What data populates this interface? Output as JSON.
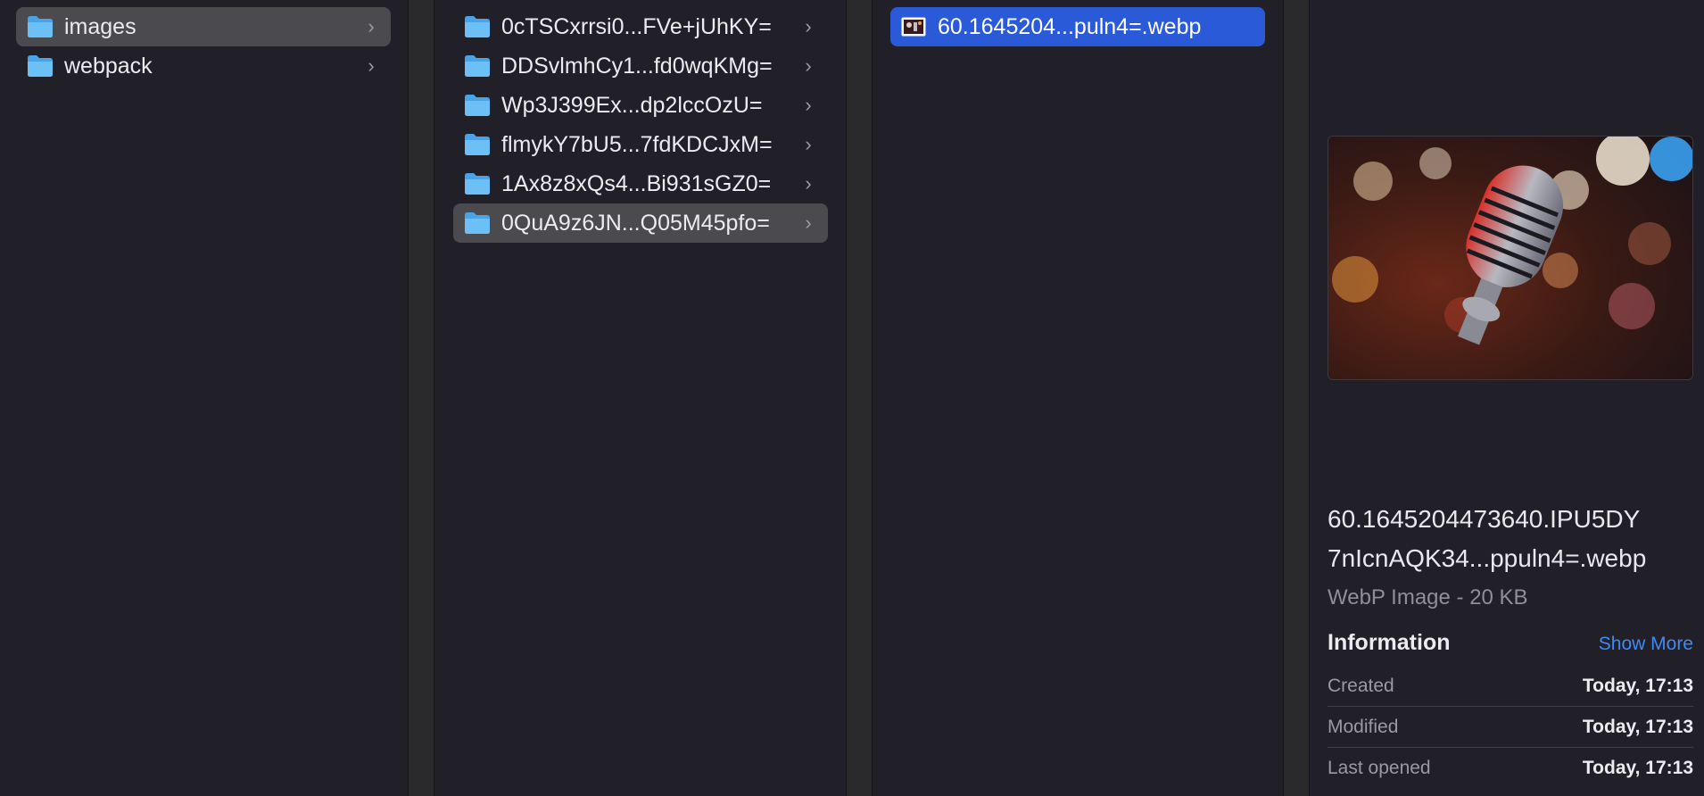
{
  "column1": {
    "items": [
      {
        "label": "images"
      },
      {
        "label": "webpack"
      }
    ]
  },
  "column2": {
    "items": [
      {
        "label": "0cTSCxrrsi0...FVe+jUhKY="
      },
      {
        "label": "DDSvlmhCy1...fd0wqKMg="
      },
      {
        "label": "Wp3J399Ex...dp2lccOzU="
      },
      {
        "label": "flmykY7bU5...7fdKDCJxM="
      },
      {
        "label": "1Ax8z8xQs4...Bi931sGZ0="
      },
      {
        "label": "0QuA9z6JN...Q05M45pfo="
      }
    ]
  },
  "column3": {
    "items": [
      {
        "label": "60.1645204...puln4=.webp"
      }
    ]
  },
  "preview": {
    "filename_line1": "60.1645204473640.IPU5DY",
    "filename_line2": "7nIcnAQK34...ppuln4=.webp",
    "filetype": "WebP Image - 20 KB",
    "info_title": "Information",
    "show_more": "Show More",
    "meta": [
      {
        "key": "Created",
        "value": "Today, 17:13"
      },
      {
        "key": "Modified",
        "value": "Today, 17:13"
      },
      {
        "key": "Last opened",
        "value": "Today, 17:13"
      }
    ]
  },
  "icons": {
    "folder": "folder-icon",
    "chevron": "chevron-right-icon",
    "image_file": "image-file-icon"
  },
  "colors": {
    "background": "#211f28",
    "selection_blue": "#2a5ad8",
    "selection_gray": "#4a4a4f",
    "link_blue": "#3f8bf3",
    "folder_blue": "#5cb3f0"
  }
}
